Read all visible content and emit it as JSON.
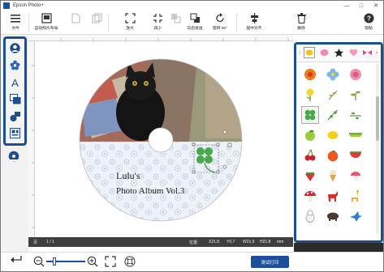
{
  "window": {
    "title": "Epson Photo+",
    "controls": {
      "minimize": "—",
      "maximize": "□",
      "close": "✕"
    }
  },
  "toolbar": {
    "menu_label": "文件",
    "auto_layout_label": "自动照片布局",
    "zoom_in_label": "放大",
    "zoom_out_label": "减小",
    "send_back_label": "向后发送",
    "rotate_label": "旋转 90°",
    "center_label": "居中对齐",
    "delete_label": "删除",
    "help_label": "帮助"
  },
  "canvas": {
    "disc_line1": "Lulu's",
    "disc_line2": "Photo Album Vol.3"
  },
  "status": {
    "page_label": "页",
    "page_value": "1 / 1",
    "position_label": "位置:",
    "x": "X21.8",
    "y": "Y0.7",
    "w": "W21.9",
    "h": "H21.8",
    "unit": "mm"
  },
  "footer": {
    "print_label": "测试打印"
  },
  "colors": {
    "accent": "#1f4e8c",
    "status_bg": "#3f3f3f"
  }
}
